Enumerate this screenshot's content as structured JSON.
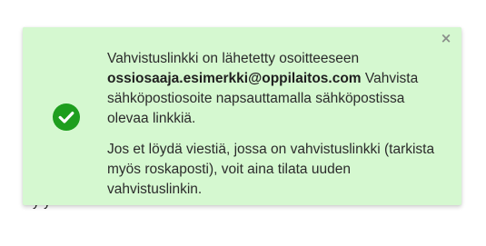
{
  "background": {
    "partial_text": "y     y"
  },
  "notice": {
    "close_label": "×",
    "message_prefix": "Vahvistuslinkki on lähetetty osoitteeseen",
    "email": "ossiosaaja.esimerkki@oppilaitos.com",
    "message_suffix": "Vahvista sähköpostiosoite napsauttamalla sähköpostissa olevaa linkkiä.",
    "resend_text": "Jos et löydä viestiä, jossa on vahvistuslinkki (tarkista myös roskaposti), voit aina tilata uuden vahvistuslinkin.",
    "icon": "check-circle-icon"
  },
  "colors": {
    "notice_background": "#d5f8d0",
    "success_green": "#1e9e1e"
  }
}
